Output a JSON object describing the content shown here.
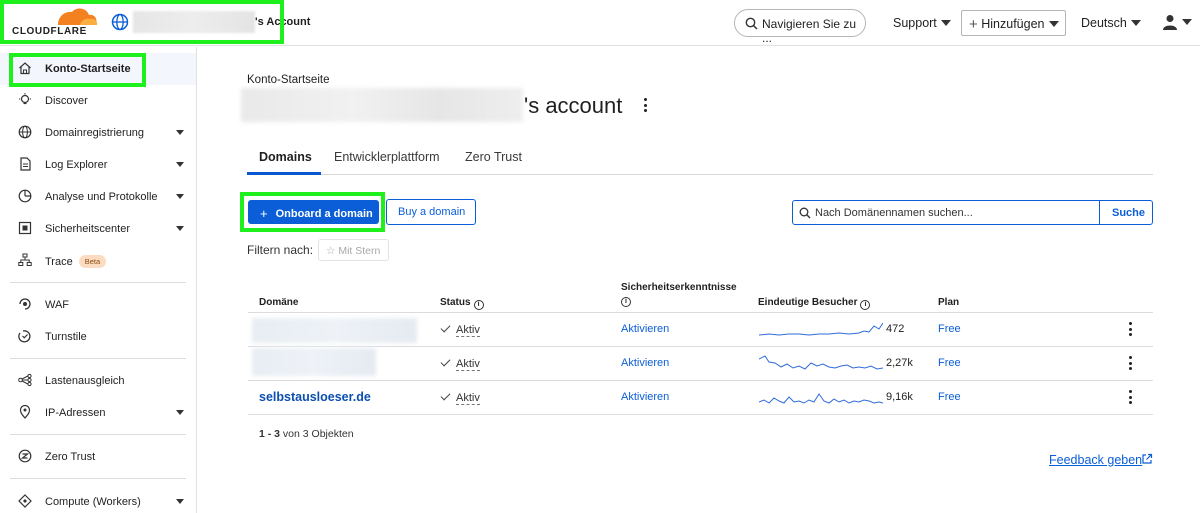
{
  "topbar": {
    "logo_text": "CLOUDFLARE",
    "account_suffix": "'s Account",
    "nav_search": "Navigieren Sie zu ...",
    "support": "Support",
    "add": "Hinzufügen",
    "language": "Deutsch"
  },
  "sidebar": {
    "items": [
      {
        "label": "Konto-Startseite",
        "icon": "home-icon"
      },
      {
        "label": "Discover",
        "icon": "lightbulb-icon"
      },
      {
        "label": "Domainregistrierung",
        "icon": "globe-icon"
      },
      {
        "label": "Log Explorer",
        "icon": "document-icon"
      },
      {
        "label": "Analyse und Protokolle",
        "icon": "clock-chart-icon"
      },
      {
        "label": "Sicherheitscenter",
        "icon": "security-center-icon"
      },
      {
        "label": "Trace",
        "icon": "trace-icon",
        "badge": "Beta"
      },
      {
        "label": "WAF",
        "icon": "waf-icon"
      },
      {
        "label": "Turnstile",
        "icon": "turnstile-icon"
      },
      {
        "label": "Lastenausgleich",
        "icon": "load-balancing-icon"
      },
      {
        "label": "IP-Adressen",
        "icon": "location-pin-icon"
      },
      {
        "label": "Zero Trust",
        "icon": "zero-trust-icon"
      },
      {
        "label": "Compute (Workers)",
        "icon": "workers-icon"
      }
    ]
  },
  "main": {
    "breadcrumb": "Konto-Startseite",
    "title_suffix": "'s account",
    "tabs": [
      "Domains",
      "Entwicklerplattform",
      "Zero Trust"
    ],
    "onboard_button": "Onboard a domain",
    "buy_button": "Buy a domain",
    "search_placeholder": "Nach Domänennamen suchen...",
    "search_button": "Suche",
    "filter_label": "Filtern nach:",
    "filter_star": "Mit Stern",
    "table": {
      "headers": {
        "domain": "Domäne",
        "status": "Status",
        "security": "Sicherheitserkenntnisse",
        "visitors": "Eindeutige Besucher",
        "plan": "Plan"
      },
      "rows": [
        {
          "domain": "",
          "status": "Aktiv",
          "security": "Aktivieren",
          "visitors": "472",
          "plan": "Free"
        },
        {
          "domain": "",
          "status": "Aktiv",
          "security": "Aktivieren",
          "visitors": "2,27k",
          "plan": "Free"
        },
        {
          "domain": "selbstausloeser.de",
          "status": "Aktiv",
          "security": "Aktivieren",
          "visitors": "9,16k",
          "plan": "Free"
        }
      ]
    },
    "pager_range": "1 - 3",
    "pager_suffix": " von 3 Objekten",
    "feedback": "Feedback geben"
  },
  "colors": {
    "accent": "#0b5ed7",
    "highlight": "#1ef01e",
    "logo_orange": "#f48120"
  }
}
